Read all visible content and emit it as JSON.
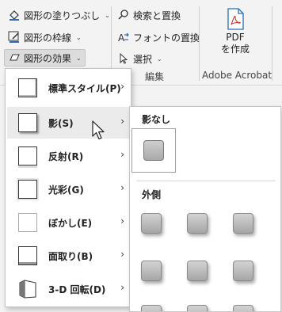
{
  "ribbon": {
    "fill_label": "図形の塗りつぶし",
    "outline_label": "図形の枠線",
    "effects_label": "図形の効果",
    "find_replace_label": "検索と置換",
    "font_replace_label": "フォントの置換",
    "select_label": "選択",
    "edit_group_label": "編集",
    "pdf_line1": "PDF",
    "pdf_line2": "を作成",
    "acrobat_group_label": "Adobe Acrobat",
    "caret": "⌄"
  },
  "menu": {
    "items": [
      {
        "label": "標準スタイル(P)",
        "icon": "preset-style-icon"
      },
      {
        "label": "影(S)",
        "icon": "shadow-icon"
      },
      {
        "label": "反射(R)",
        "icon": "reflection-icon"
      },
      {
        "label": "光彩(G)",
        "icon": "glow-icon"
      },
      {
        "label": "ぼかし(E)",
        "icon": "soft-edges-icon"
      },
      {
        "label": "面取り(B)",
        "icon": "bevel-icon"
      },
      {
        "label": "3-D 回転(D)",
        "icon": "3d-rotation-icon"
      }
    ],
    "arrow": "›",
    "hovered_index": 1
  },
  "submenu": {
    "no_shadow_label": "影なし",
    "outer_label": "外側"
  }
}
